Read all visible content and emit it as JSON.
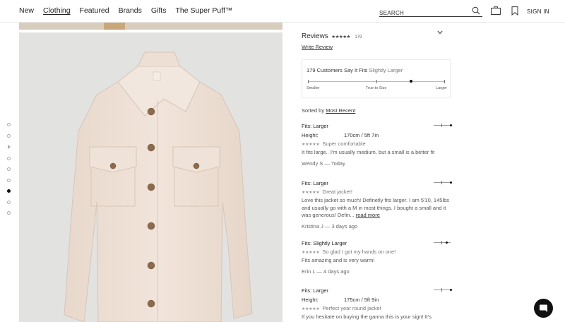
{
  "header": {
    "nav": [
      "New",
      "Clothing",
      "Featured",
      "Brands",
      "Gifts",
      "The Super Puff™"
    ],
    "active_nav": "Clothing",
    "search_placeholder": "SEARCH",
    "signin_label": "SIGN IN"
  },
  "gallery": {
    "thumbnail_count": 9,
    "active_index": 6
  },
  "reviews": {
    "title": "Reviews",
    "stars": "★★★★★",
    "count": "179",
    "write_review": "Write Review"
  },
  "fit_summary": {
    "prefix": "179 Customers Say It Fits",
    "value": "Slightly Larger",
    "labels": [
      "Smaller",
      "True to Size",
      "Larger"
    ],
    "position_fraction": 0.75
  },
  "sort": {
    "label": "Sorted by",
    "value": "Most Recent"
  },
  "review_list": [
    {
      "fits": "Fits: Larger",
      "fit_fraction": 1.0,
      "height_label": "Height:",
      "height": "170cm / 5ft 7in",
      "stars": "★★★★★",
      "title": "Super comfortable",
      "body": "It fits large.. I'm usually medium, but a small is a better fit",
      "read_more": "",
      "author": "Wendy S — Today"
    },
    {
      "fits": "Fits: Larger",
      "fit_fraction": 1.0,
      "height_label": "",
      "height": "",
      "stars": "★★★★★",
      "title": "Great jacket!",
      "body": "Love this jacket so much! Definetly fits larger. I am 5'10, 145lbs and usually go with a M in most things. I bought a small and it was generous! Defin...",
      "read_more": "read more",
      "author": "Kristina J — 3 days ago"
    },
    {
      "fits": "Fits: Slightly Larger",
      "fit_fraction": 0.75,
      "height_label": "",
      "height": "",
      "stars": "★★★★★",
      "title": "So glad I got my hands on one!",
      "body": "Fits amazing and is very warm!",
      "read_more": "",
      "author": "Erin L — 4 days ago"
    },
    {
      "fits": "Fits: Larger",
      "fit_fraction": 1.0,
      "height_label": "Height:",
      "height": "175cm / 5ft 9in",
      "stars": "★★★★★",
      "title": "Perfect year round jacket",
      "body": "If you hesitate on buying the ganna this is your sign! It's",
      "read_more": "",
      "author": ""
    }
  ],
  "colors": {
    "accent": "#111111",
    "jacket": "#efe1d6",
    "background_photo": "#e2e2e1"
  }
}
